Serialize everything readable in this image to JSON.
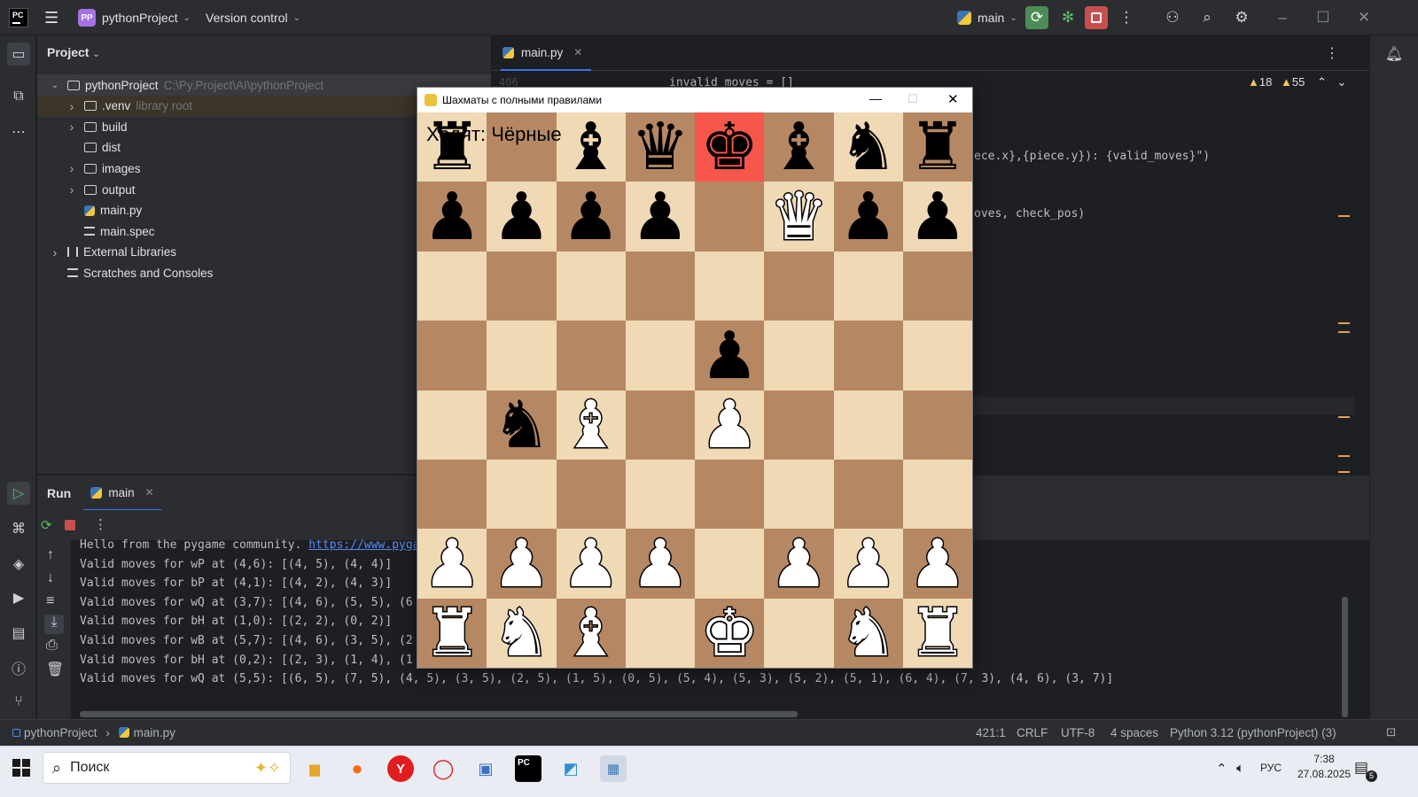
{
  "titlebar": {
    "project_badge": "PP",
    "project_name": "pythonProject",
    "vcs": "Version control",
    "branch": "main",
    "logo": "PC"
  },
  "project_panel": {
    "title": "Project",
    "tree": [
      {
        "label": "pythonProject",
        "extra": "C:\\Py.Project\\AI\\pythonProject",
        "indent": 0,
        "arrow": "open",
        "kind": "folder"
      },
      {
        "label": ".venv",
        "extra": "library root",
        "indent": 1,
        "arrow": "closed",
        "kind": "folder"
      },
      {
        "label": "build",
        "extra": "",
        "indent": 1,
        "arrow": "closed",
        "kind": "folder"
      },
      {
        "label": "dist",
        "extra": "",
        "indent": 1,
        "arrow": "",
        "kind": "folder"
      },
      {
        "label": "images",
        "extra": "",
        "indent": 1,
        "arrow": "closed",
        "kind": "folder"
      },
      {
        "label": "output",
        "extra": "",
        "indent": 1,
        "arrow": "closed",
        "kind": "folder"
      },
      {
        "label": "main.py",
        "extra": "",
        "indent": 1,
        "arrow": "",
        "kind": "python"
      },
      {
        "label": "main.spec",
        "extra": "",
        "indent": 1,
        "arrow": "",
        "kind": "text"
      },
      {
        "label": "External Libraries",
        "extra": "",
        "indent": 0,
        "arrow": "closed",
        "kind": "library"
      },
      {
        "label": "Scratches and Consoles",
        "extra": "",
        "indent": 0,
        "arrow": "",
        "kind": "scratch"
      }
    ]
  },
  "editor": {
    "tab": "main.py",
    "line_number": "406",
    "warnings": "18",
    "weak_warnings": "55",
    "code_lines": [
      "invalid_moves = []",
      "ece.x},{piece.y}): {valid_moves}\")",
      "oves, check_pos)"
    ]
  },
  "run_panel": {
    "title": "Run",
    "tab": "main",
    "lines": [
      {
        "text": "Hello from the pygame community. ",
        "link": "https://www.pyga"
      },
      {
        "text": "Valid moves for wP at (4,6): [(4, 5), (4, 4)]",
        "link": ""
      },
      {
        "text": "Valid moves for bP at (4,1): [(4, 2), (4, 3)]",
        "link": ""
      },
      {
        "text": "Valid moves for wQ at (3,7): [(4, 6), (5, 5), (6",
        "link": ""
      },
      {
        "text": "Valid moves for bH at (1,0): [(2, 2), (0, 2)]",
        "link": ""
      },
      {
        "text": "Valid moves for wB at (5,7): [(4, 6), (3, 5), (2",
        "link": ""
      },
      {
        "text": "Valid moves for bH at (0,2): [(2, 3), (1, 4), (1",
        "link": ""
      },
      {
        "text": "Valid moves for wQ at (5,5): [(6, 5), (7, 5), (4, 5), (3, 5), (2, 5), (1, 5), (0, 5), (5, 4), (5, 3), (5, 2), (5, 1), (6, 4), (7, 3), (4, 6), (3, 7)]",
        "link": ""
      }
    ]
  },
  "statusbar": {
    "crumb_project": "pythonProject",
    "crumb_file": "main.py",
    "position": "421:1",
    "line_sep": "CRLF",
    "encoding": "UTF-8",
    "indent": "4 spaces",
    "interpreter": "Python 3.12 (pythonProject) (3)"
  },
  "taskbar": {
    "search": "Поиск",
    "lang": "РУС",
    "time": "7:38",
    "date": "27.08.2025",
    "notif_count": "5"
  },
  "pygame": {
    "title": "Шахматы с полными правилами",
    "turn_label": "Ходят: Чёрные",
    "light_color": "#f0d9b5",
    "dark_color": "#b58863",
    "check_color": "#f7564a",
    "board": [
      [
        "bR",
        "",
        "bB",
        "bQ",
        "bK",
        "bB",
        "bH",
        "bR"
      ],
      [
        "bP",
        "bP",
        "bP",
        "bP",
        "",
        "wQ",
        "bP",
        "bP"
      ],
      [
        "",
        "",
        "",
        "",
        "",
        "",
        "",
        ""
      ],
      [
        "",
        "",
        "",
        "",
        "bP",
        "",
        "",
        ""
      ],
      [
        "",
        "bH",
        "wB",
        "",
        "wP",
        "",
        "",
        ""
      ],
      [
        "",
        "",
        "",
        "",
        "",
        "",
        "",
        ""
      ],
      [
        "wP",
        "wP",
        "wP",
        "wP",
        "",
        "wP",
        "wP",
        "wP"
      ],
      [
        "wR",
        "wH",
        "wB",
        "",
        "wK",
        "",
        "wH",
        "wR"
      ]
    ],
    "check_square": [
      0,
      4
    ]
  }
}
